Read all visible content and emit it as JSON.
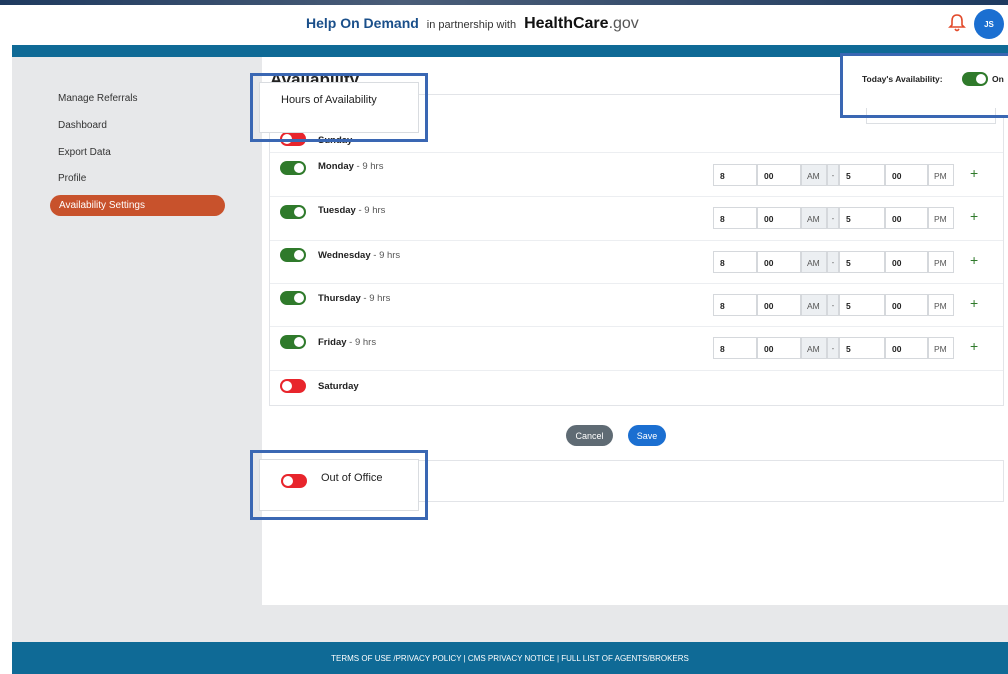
{
  "header": {
    "brand_name": "Help On Demand",
    "partner_text": "in partnership with",
    "healthcare": "HealthCare",
    "gov": ".gov",
    "avatar_initials": "JS"
  },
  "sidebar": {
    "items": [
      {
        "label": "Manage Referrals"
      },
      {
        "label": "Dashboard"
      },
      {
        "label": "Export Data"
      },
      {
        "label": "Profile"
      },
      {
        "label": "Availability Settings"
      }
    ]
  },
  "page": {
    "title": "Availability",
    "hours_heading": "Hours of Availability",
    "today_label": "Today's Availability:",
    "today_state": "On"
  },
  "days": [
    {
      "name": "Sunday",
      "enabled": false,
      "hours": ""
    },
    {
      "name": "Monday",
      "enabled": true,
      "hours": " - 9 hrs",
      "start_h": "8",
      "start_m": "00",
      "start_ap": "AM",
      "end_h": "5",
      "end_m": "00",
      "end_ap": "PM"
    },
    {
      "name": "Tuesday",
      "enabled": true,
      "hours": " - 9 hrs",
      "start_h": "8",
      "start_m": "00",
      "start_ap": "AM",
      "end_h": "5",
      "end_m": "00",
      "end_ap": "PM"
    },
    {
      "name": "Wednesday",
      "enabled": true,
      "hours": " - 9 hrs",
      "start_h": "8",
      "start_m": "00",
      "start_ap": "AM",
      "end_h": "5",
      "end_m": "00",
      "end_ap": "PM"
    },
    {
      "name": "Thursday",
      "enabled": true,
      "hours": " - 9 hrs",
      "start_h": "8",
      "start_m": "00",
      "start_ap": "AM",
      "end_h": "5",
      "end_m": "00",
      "end_ap": "PM"
    },
    {
      "name": "Friday",
      "enabled": true,
      "hours": " - 9 hrs",
      "start_h": "8",
      "start_m": "00",
      "start_ap": "AM",
      "end_h": "5",
      "end_m": "00",
      "end_ap": "PM"
    },
    {
      "name": "Saturday",
      "enabled": false,
      "hours": ""
    }
  ],
  "separator": "-",
  "plus": "+",
  "actions": {
    "cancel": "Cancel",
    "save": "Save"
  },
  "out_of_office": {
    "label": "Out of Office",
    "enabled": false
  },
  "footer": {
    "links": "TERMS OF USE /PRIVACY POLICY | CMS PRIVACY NOTICE | FULL LIST OF AGENTS/BROKERS"
  },
  "colors": {
    "accent": "#c8522c",
    "brand_blue": "#0f6a96",
    "toggle_on": "#2f7a2b",
    "toggle_off": "#e8252c",
    "highlight": "#3a67b3"
  }
}
